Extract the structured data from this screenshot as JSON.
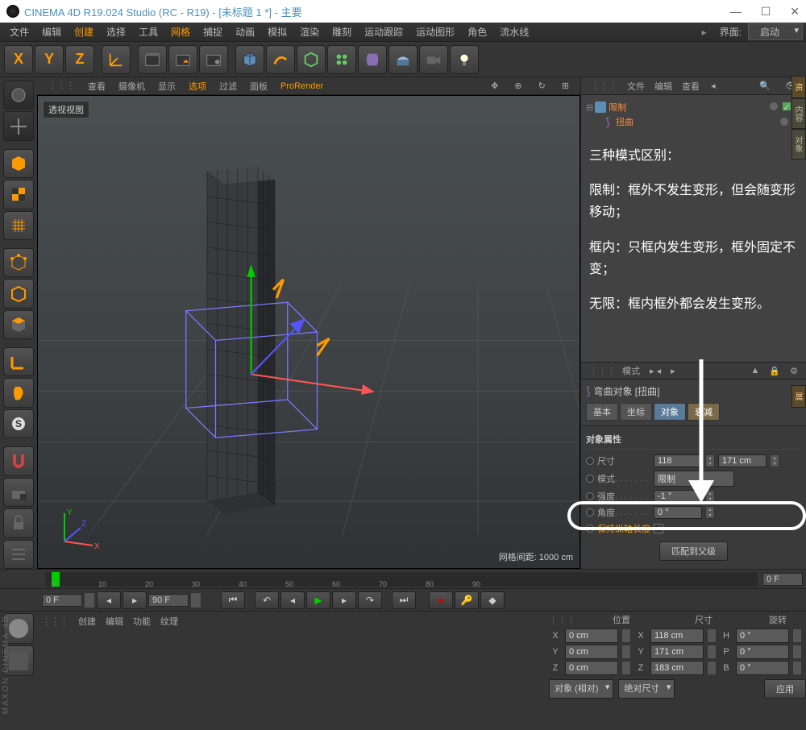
{
  "title": "CINEMA 4D R19.024 Studio (RC - R19) - [未标题 1 *] - 主要",
  "menu": {
    "items": [
      "文件",
      "编辑",
      "创建",
      "选择",
      "工具",
      "网格",
      "捕捉",
      "动画",
      "模拟",
      "渲染",
      "雕刻",
      "运动跟踪",
      "运动图形",
      "角色",
      "流水线"
    ],
    "highlight": [
      "创建",
      "网格"
    ],
    "layout_label": "界面:",
    "layout_value": "启动"
  },
  "toolbar": {
    "xyz": [
      "X",
      "Y",
      "Z"
    ]
  },
  "viewport": {
    "menu": [
      "查看",
      "摄像机",
      "显示",
      "选项",
      "过滤",
      "面板",
      "ProRender"
    ],
    "menu_highlight": "选项",
    "label": "透视视图",
    "grid_info": "网格间距: 1000 cm"
  },
  "right_panel_menu": [
    "文件",
    "编辑",
    "查看"
  ],
  "objects": {
    "root": "限制",
    "child": "扭曲"
  },
  "annotation": {
    "title": "三种模式区别：",
    "l1": "限制：框外不发生变形，但会随变形移动；",
    "l2": "框内：只框内发生变形，框外固定不变；",
    "l3": "无限：框内框外都会发生变形。"
  },
  "attr": {
    "menu_mode": "模式",
    "object_title": "弯曲对象 [扭曲]",
    "tabs": [
      "基本",
      "坐标",
      "对象",
      "衰减"
    ],
    "section": "对象属性",
    "rows": {
      "size_label": "尺寸",
      "size_v1": "118",
      "size_v2": "171 cm",
      "mode_label": "模式",
      "mode_value": "限制",
      "strength_label": "强度",
      "strength_value": "-1 °",
      "angle_label": "角度",
      "angle_value": "0 °",
      "keep_label": "保持纵轴长度"
    },
    "fit_button": "匹配到父级"
  },
  "timeline": {
    "ticks": [
      0,
      10,
      20,
      30,
      40,
      50,
      60,
      70,
      80,
      90
    ],
    "current": "0 F",
    "start": "0 F",
    "end": "90 F"
  },
  "coords": {
    "menu": [
      "创建",
      "编辑",
      "功能",
      "纹理"
    ],
    "headers": [
      "位置",
      "尺寸",
      "旋转"
    ],
    "rows": [
      {
        "axis": "X",
        "pos": "0 cm",
        "size": "118 cm",
        "rot": "H",
        "rotv": "0 °"
      },
      {
        "axis": "Y",
        "pos": "0 cm",
        "size": "171 cm",
        "rot": "P",
        "rotv": "0 °"
      },
      {
        "axis": "Z",
        "pos": "0 cm",
        "size": "183 cm",
        "rot": "B",
        "rotv": "0 °"
      }
    ],
    "mode1": "对象 (相对)",
    "mode2": "绝对尺寸",
    "apply": "应用"
  },
  "maxon": "MAXON CINEMA 4D"
}
